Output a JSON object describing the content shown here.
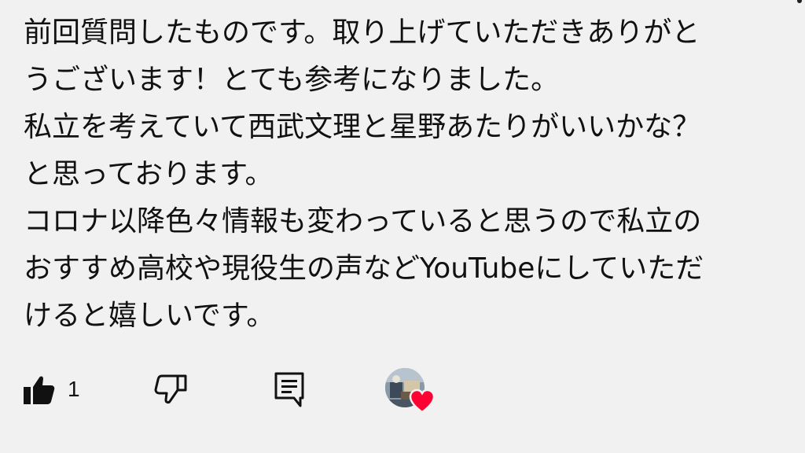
{
  "comment": {
    "lines": [
      "前回質問したものです。取り上げていただきありがと",
      "うございます！とても参考になりました。",
      "私立を考えていて西武文理と星野あたりがいいかな？",
      "と思っております。",
      "コロナ以降色々情報も変わっていると思うので私立の",
      "おすすめ高校や現役生の声などYouTubeにしていただ",
      "けると嬉しいです。"
    ]
  },
  "actions": {
    "like_icon": "thumbs-up-filled-icon",
    "like_count": "1",
    "dislike_icon": "thumbs-down-outline-icon",
    "reply_icon": "reply-comment-icon",
    "creator_heart_icon": "heart-icon"
  },
  "colors": {
    "background": "#f2f1f2",
    "text": "#111111",
    "heart": "#ff0033"
  }
}
